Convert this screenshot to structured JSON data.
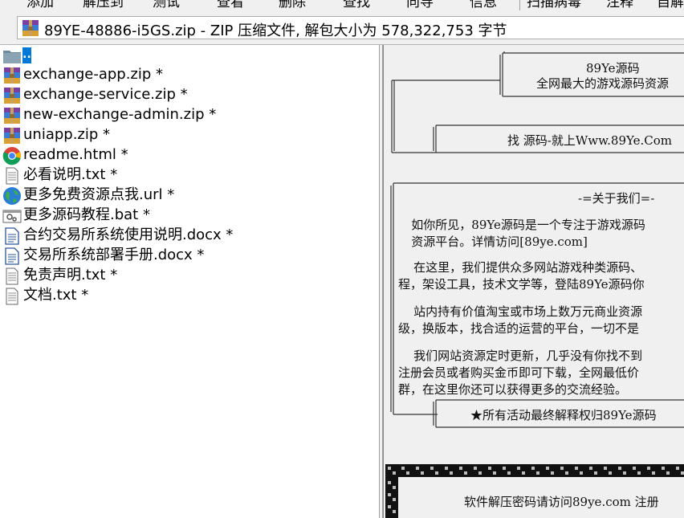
{
  "toolbar": {
    "items": [
      "添加",
      "解压到",
      "测试",
      "查看",
      "删除",
      "查找",
      "向导",
      "信息",
      "扫描病毒",
      "注释",
      "自解"
    ]
  },
  "address": {
    "text": "89YE-48886-i5GS.zip - ZIP 压缩文件, 解包大小为 578,322,753 字节"
  },
  "files": [
    {
      "name": "..",
      "icon": "folder-up-icon"
    },
    {
      "name": "exchange-app.zip *",
      "icon": "zip-archive-icon"
    },
    {
      "name": "exchange-service.zip *",
      "icon": "zip-archive-icon"
    },
    {
      "name": "new-exchange-admin.zip *",
      "icon": "zip-archive-icon"
    },
    {
      "name": "uniapp.zip *",
      "icon": "zip-archive-icon"
    },
    {
      "name": "readme.html *",
      "icon": "chrome-icon"
    },
    {
      "name": "必看说明.txt *",
      "icon": "text-file-icon"
    },
    {
      "name": "更多免费资源点我.url *",
      "icon": "globe-icon"
    },
    {
      "name": "更多源码教程.bat *",
      "icon": "batch-file-icon"
    },
    {
      "name": "合约交易所系统使用说明.docx *",
      "icon": "word-doc-icon"
    },
    {
      "name": "交易所系统部署手册.docx *",
      "icon": "word-doc-icon"
    },
    {
      "name": "免责声明.txt *",
      "icon": "text-file-icon"
    },
    {
      "name": "文档.txt *",
      "icon": "text-file-icon"
    }
  ],
  "comment": {
    "header_line1": "89Ye源码",
    "header_line2": "全网最大的游戏源码资源",
    "find_line": "找 源码-就上Www.89Ye.Com",
    "about_title": "-=关于我们=-",
    "para1": "   如你所见，89Ye源码是一个专注于游戏源码\n   资源平台。详情访问[89ye.com]",
    "para2": "    在这里，我们提供众多网站游戏种类源码、\n程，架设工具，技术文学等，登陆89Ye源码你",
    "para3": "    站内持有价值淘宝或市场上数万元商业资源\n级，换版本，找合适的运营的平台，一切不是",
    "para4": "    我们网站资源定时更新，几乎没有你找不到\n注册会员或者购买金币即可下载，全网最低价\n群，在这里你还可以获得更多的交流经验。",
    "final_line": "★所有活动最终解释权归89Ye源码",
    "bottom_line": "软件解压密码请访问89ye.com 注册"
  },
  "colors": {
    "selection": "#0078d7",
    "pane_bg": "#f0f0f0",
    "list_bg": "#ffffff"
  }
}
